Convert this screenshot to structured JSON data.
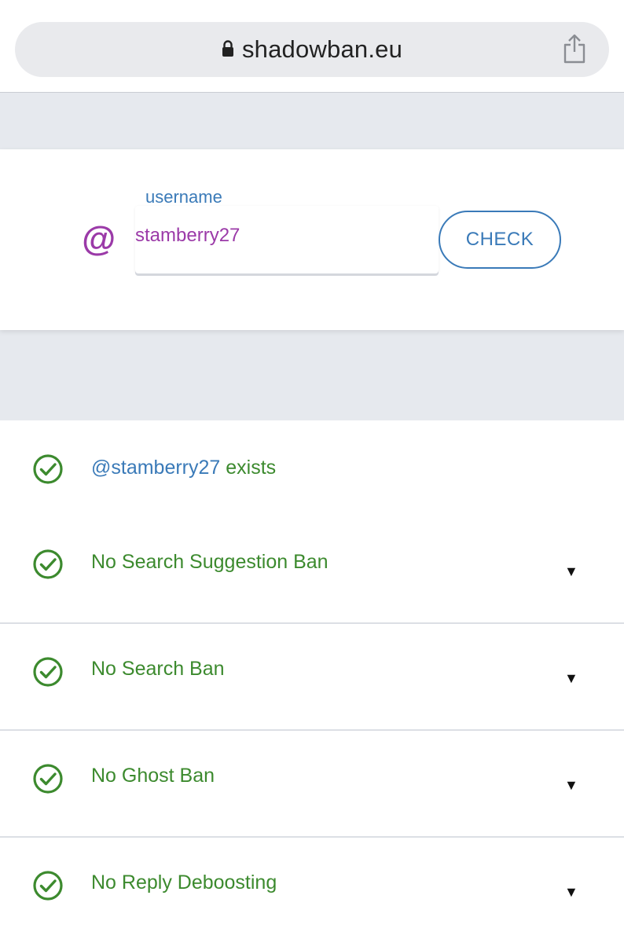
{
  "browser": {
    "url": "shadowban.eu",
    "lock_icon": "lock-icon",
    "share_icon": "share-icon"
  },
  "check_form": {
    "at_symbol": "@",
    "field_label": "username",
    "username_value": "stamberry27",
    "check_button_label": "CHECK"
  },
  "results": {
    "exists": {
      "handle": "@stamberry27",
      "suffix": " exists"
    },
    "items": [
      {
        "label": "No Search Suggestion Ban",
        "expand_glyph": "▼"
      },
      {
        "label": "No Search Ban",
        "expand_glyph": "▼"
      },
      {
        "label": "No Ghost Ban",
        "expand_glyph": "▼"
      },
      {
        "label": "No Reply Deboosting",
        "expand_glyph": "▼"
      }
    ]
  },
  "colors": {
    "accent_blue": "#3a7ab8",
    "accent_purple": "#9b3aa8",
    "status_green": "#3c8a2e",
    "page_background": "#e6e9ee"
  }
}
